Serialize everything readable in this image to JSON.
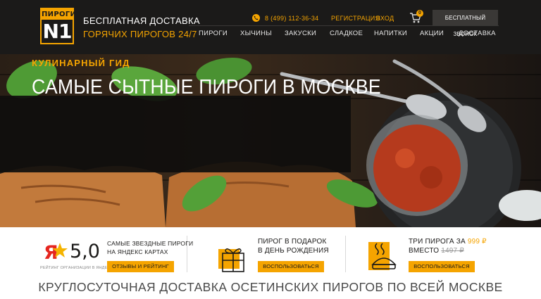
{
  "header": {
    "logo_top": "ПИРОГИ",
    "logo_bottom": "N1",
    "tagline_line1": "БЕСПЛАТНАЯ ДОСТАВКА",
    "tagline_line2": "ГОРЯЧИХ ПИРОГОВ 24/7",
    "phone": "8 (499) 112-36-34",
    "register_label": "РЕГИСТРАЦИЯ",
    "login_label": "ВХОД",
    "cart_count": "0",
    "callback_label": "БЕСПЛАТНЫЙ ЗВОНОК"
  },
  "nav": {
    "items": [
      {
        "label": "ПИРОГИ"
      },
      {
        "label": "ХЫЧИНЫ"
      },
      {
        "label": "ЗАКУСКИ"
      },
      {
        "label": "СЛАДКОЕ"
      },
      {
        "label": "НАПИТКИ"
      },
      {
        "label": "АКЦИИ"
      },
      {
        "label": "ДОСТАВКА"
      }
    ]
  },
  "hero": {
    "kicker": "КУЛИНАРНЫЙ ГИД",
    "headline": "САМЫЕ СЫТНЫЕ ПИРОГИ В МОСКВЕ"
  },
  "features": {
    "rating": {
      "letter": "Я",
      "value": "5,0",
      "caption": "РЕЙТИНГ ОРГАНИЗАЦИИ В ЯНДЕКСЕ",
      "title_line1": "САМЫЕ ЗВЕЗДНЫЕ ПИРОГИ",
      "title_line2": "НА ЯНДЕКС КАРТАХ",
      "button": "ОТЗЫВЫ И РЕЙТИНГ"
    },
    "gift": {
      "title_line1": "ПИРОГ В ПОДАРОК",
      "title_line2": "В ДЕНЬ РОЖДЕНИЯ",
      "button": "ВОСПОЛЬЗОВАТЬСЯ"
    },
    "promo": {
      "title_prefix": "ТРИ ПИРОГА ЗА",
      "price_new": "999 ₽",
      "title_line2_prefix": "ВМЕСТО",
      "price_old": "1497 ₽",
      "button": "ВОСПОЛЬЗОВАТЬСЯ"
    }
  },
  "footer": {
    "title": "КРУГЛОСУТОЧНАЯ ДОСТАВКА ОСЕТИНСКИХ ПИРОГОВ ПО ВСЕЙ МОСКВЕ"
  },
  "colors": {
    "accent": "#f5a400",
    "header_bg": "#1b1a19",
    "yandex_red": "#e52620"
  },
  "icons": [
    "phone-icon",
    "cart-icon",
    "gift-icon",
    "pie-icon",
    "yandex-star-icon"
  ]
}
